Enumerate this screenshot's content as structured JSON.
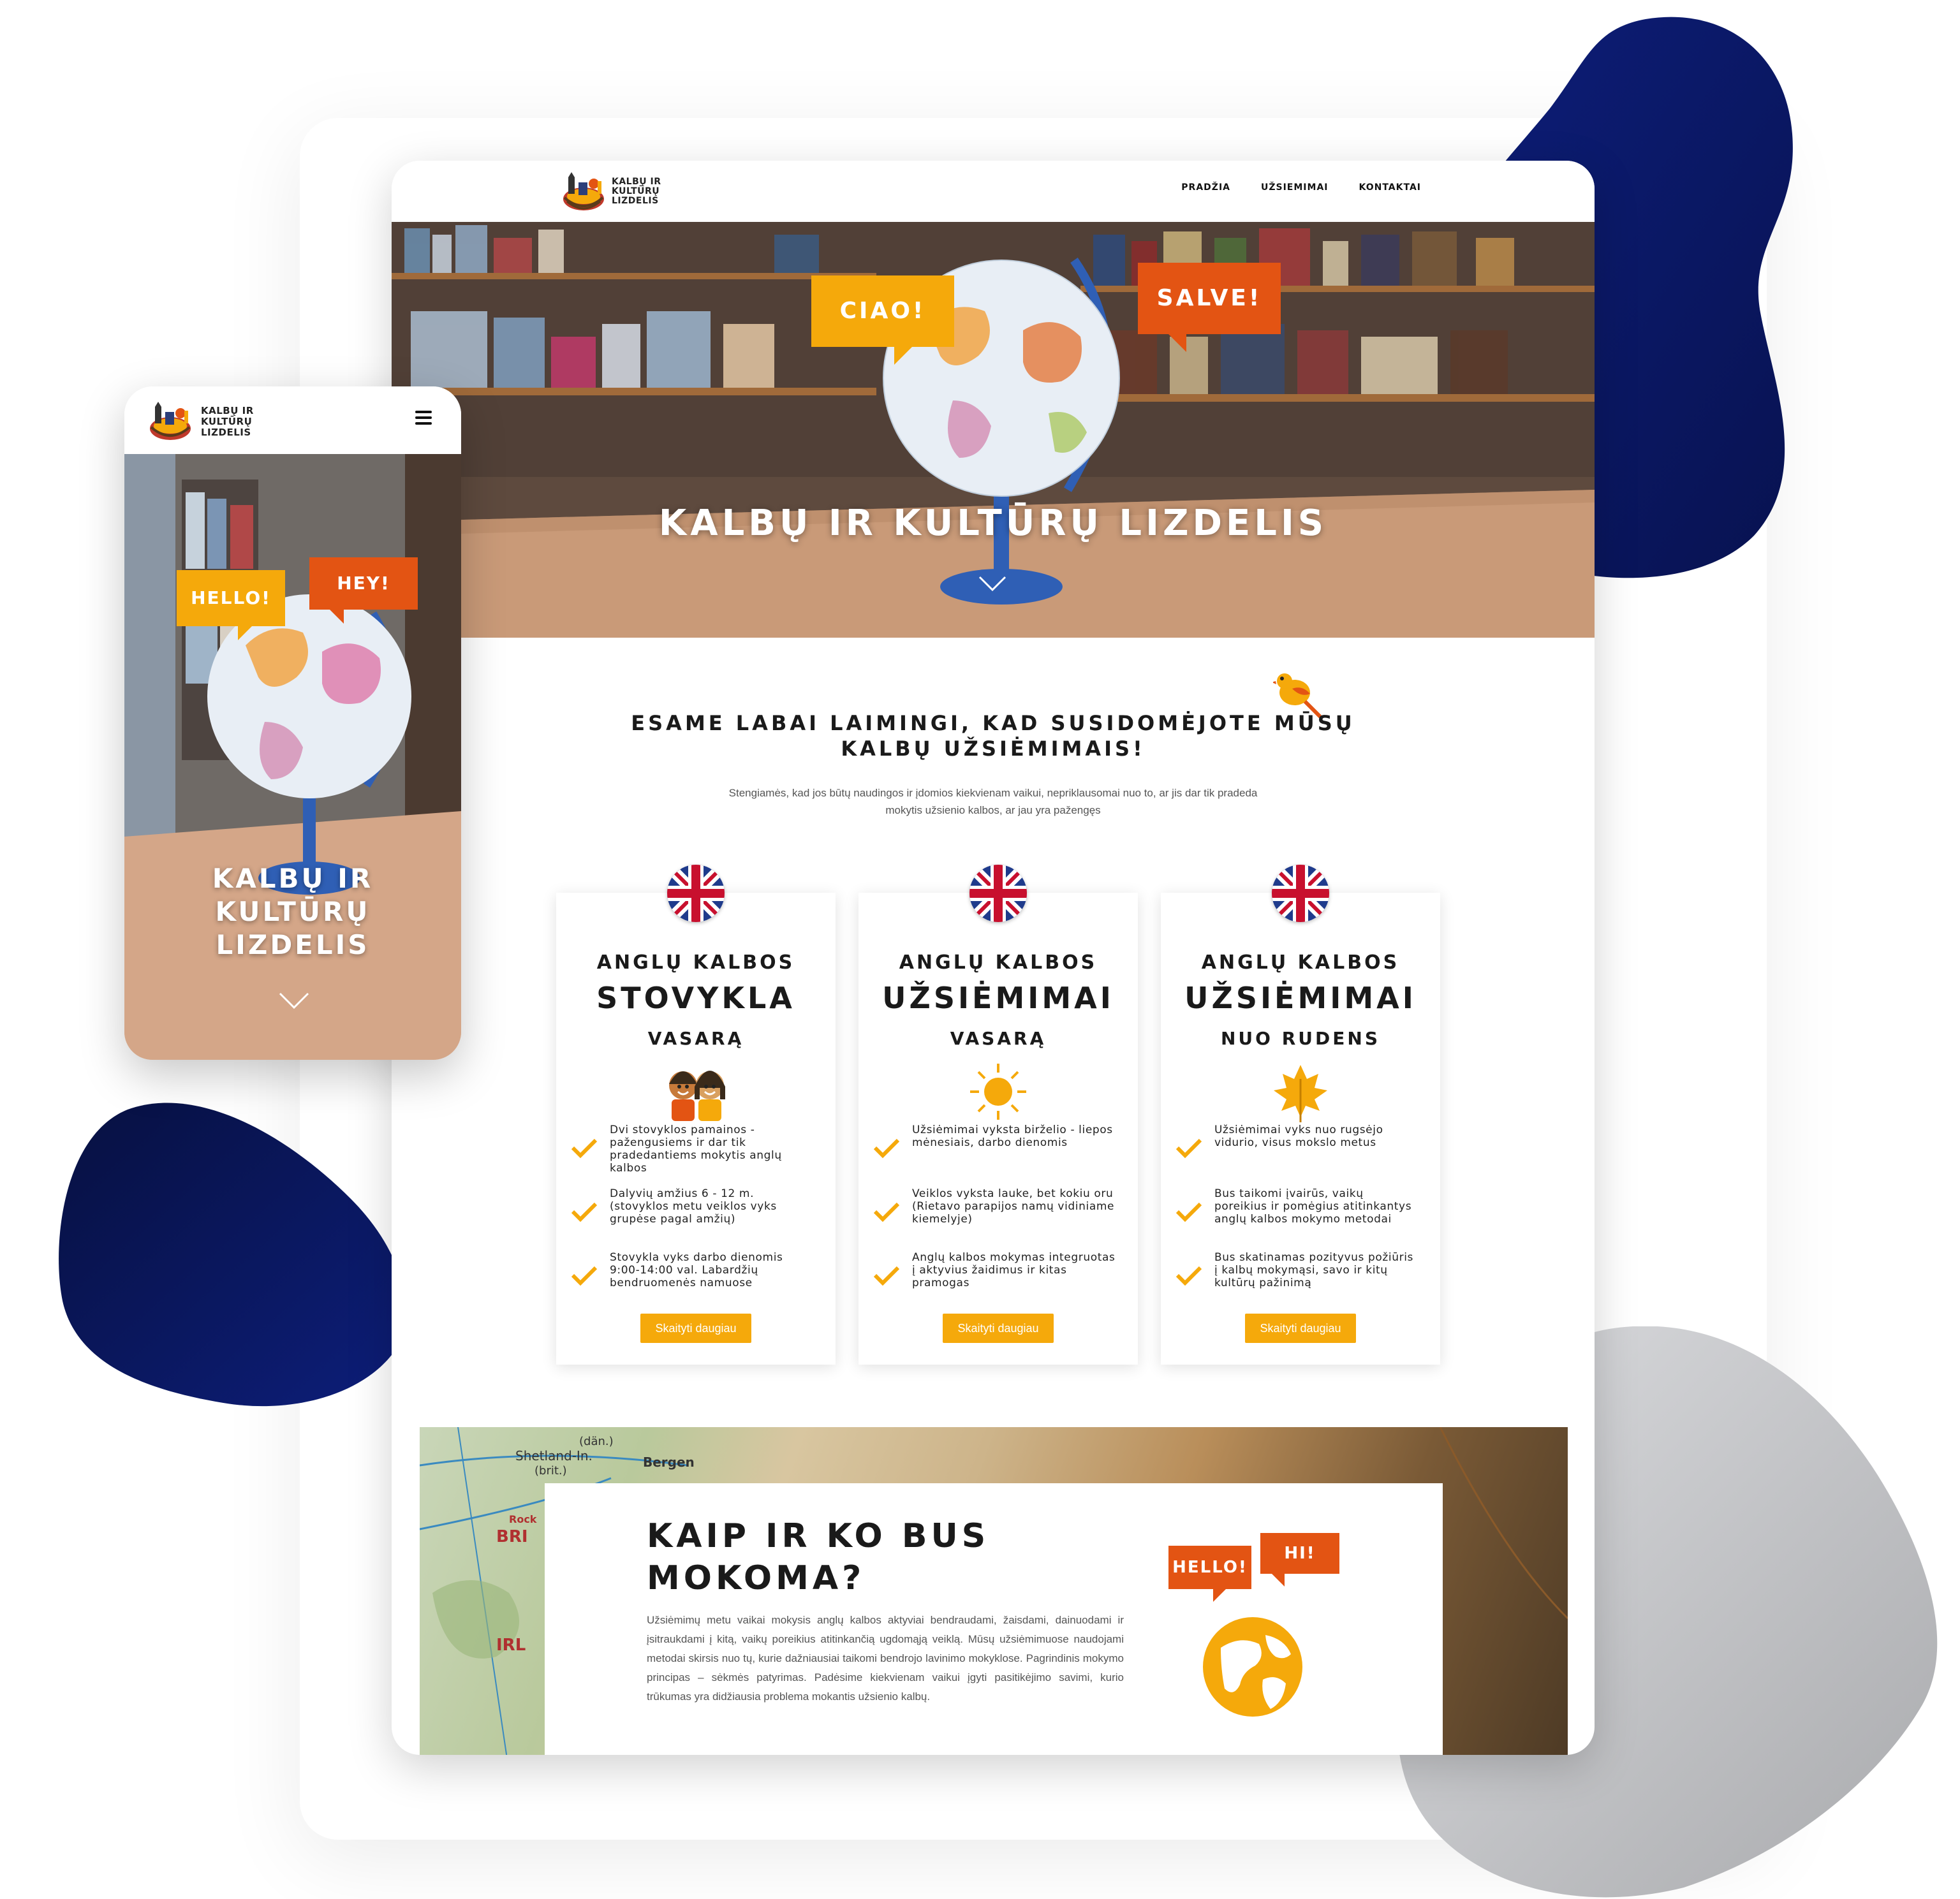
{
  "brand": {
    "logo_text": "KALBŲ IR\nKULTŪRŲ\nLIZDELIS"
  },
  "colors": {
    "accent_orange": "#f5a90b",
    "accent_red": "#e35413",
    "blob_navy": "#0d1e7a"
  },
  "desktop": {
    "nav": {
      "items": [
        "PRADŽIA",
        "UŽSIEMIMAI",
        "KONTAKTAI"
      ]
    },
    "hero": {
      "title": "KALBŲ IR KULTŪRŲ LIZDELIS",
      "bubble_left": "CIAO!",
      "bubble_right": "SALVE!"
    },
    "intro": {
      "title_line1": "ESAME LABAI LAIMINGI, KAD SUSIDOMĖJOTE MŪSŲ",
      "title_line2": "KALBŲ UŽSIĖMIMAIS!",
      "text_line1": "Stengiamės, kad jos būtų naudingos ir įdomios kiekvienam vaikui, nepriklausomai nuo to, ar jis dar tik pradeda",
      "text_line2": "mokytis užsienio kalbos, ar jau yra pažengęs"
    },
    "cards": [
      {
        "line1": "ANGLŲ KALBOS",
        "line2": "STOVYKLA",
        "line3": "VASARĄ",
        "icon": "kids-icon",
        "items": [
          "Dvi stovyklos pamainos - pažengusiems ir dar tik pradedantiems mokytis anglų kalbos",
          "Dalyvių amžius 6 - 12 m. (stovyklos metu veiklos vyks grupėse pagal amžių)",
          "Stovykla vyks darbo dienomis 9:00-14:00 val. Labardžių bendruomenės namuose"
        ],
        "button": "Skaityti daugiau"
      },
      {
        "line1": "ANGLŲ KALBOS",
        "line2": "UŽSIĖMIMAI",
        "line3": "VASARĄ",
        "icon": "sun-icon",
        "items": [
          "Užsiėmimai vyksta birželio - liepos mėnesiais, darbo dienomis",
          "Veiklos vyksta lauke, bet kokiu oru (Rietavo parapijos namų vidiniame kiemelyje)",
          "Anglų kalbos mokymas integruotas į aktyvius žaidimus ir kitas pramogas"
        ],
        "button": "Skaityti daugiau"
      },
      {
        "line1": "ANGLŲ KALBOS",
        "line2": "UŽSIĖMIMAI",
        "line3": "NUO RUDENS",
        "icon": "leaf-icon",
        "items": [
          "Užsiėmimai vyks nuo rugsėjo vidurio, visus mokslo metus",
          "Bus taikomi įvairūs, vaikų poreikius ir pomėgius atitinkantys anglų kalbos mokymo metodai",
          "Bus skatinamas pozityvus požiūris į kalbų mokymąsi, savo ir kitų kultūrų pažinimą"
        ],
        "button": "Skaityti daugiau"
      }
    ],
    "how": {
      "title_line1": "KAIP IR KO BUS",
      "title_line2": "MOKOMA?",
      "text": "Užsiėmimų metu vaikai mokysis anglų kalbos aktyviai bendraudami, žaisdami, dainuodami ir įsitraukdami į kitą, vaikų poreikius atitinkančią ugdomąją veiklą. Mūsų užsiėmimuose naudojami metodai skirsis nuo tų, kurie dažniausiai taikomi bendrojo lavinimo mokyklose. Pagrindinis mokymo principas – sėkmės patyrimas. Padėsime kiekvienam vaikui įgyti pasitikėjimo savimi, kurio trūkumas yra didžiausia problema mokantis užsienio kalbų.",
      "bubble_left": "HELLO!",
      "bubble_right": "HI!"
    },
    "map_labels": [
      "Shetland-In.",
      "(brit.)",
      "(dän.)",
      "Bergen",
      "Rock",
      "BRI",
      "IRL"
    ]
  },
  "mobile": {
    "hero": {
      "title": "KALBŲ IR\nKULTŪRŲ\nLIZDELIS",
      "bubble_left": "HELLO!",
      "bubble_right": "HEY!"
    }
  }
}
